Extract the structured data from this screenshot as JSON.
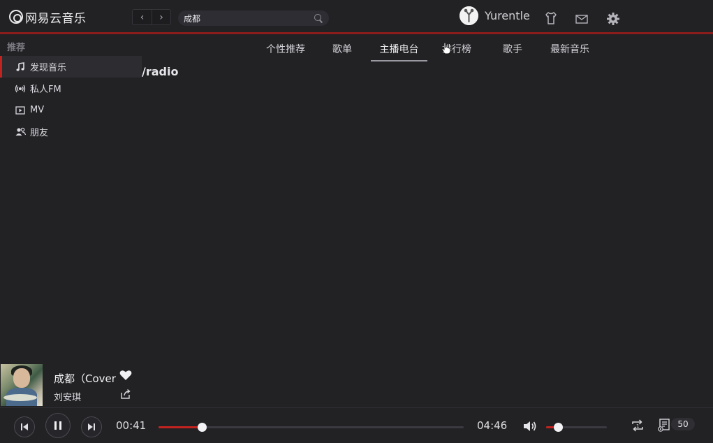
{
  "app": {
    "logo_text": "网易云音乐"
  },
  "header": {
    "back_glyph": "‹",
    "forward_glyph": "›",
    "search_value": "成都",
    "username": "Yurentle",
    "icons": [
      "skin-icon",
      "mail-icon",
      "settings-icon"
    ]
  },
  "sidebar": {
    "section_title": "推荐",
    "items": [
      {
        "label": "发现音乐",
        "icon": "music-note-icon",
        "active": true
      },
      {
        "label": "私人FM",
        "icon": "radio-icon",
        "active": false
      },
      {
        "label": "MV",
        "icon": "video-icon",
        "active": false
      },
      {
        "label": "朋友",
        "icon": "friends-icon",
        "active": false
      }
    ]
  },
  "tabs": [
    {
      "label": "个性推荐",
      "active": false
    },
    {
      "label": "歌单",
      "active": false
    },
    {
      "label": "主播电台",
      "active": true
    },
    {
      "label": "排行榜",
      "active": false
    },
    {
      "label": "歌手",
      "active": false
    },
    {
      "label": "最新音乐",
      "active": false
    }
  ],
  "main": {
    "route_text": "/radio"
  },
  "now_playing": {
    "title": "成都（Cover",
    "artist": "刘安琪",
    "liked": true
  },
  "player": {
    "current_time": "00:41",
    "total_time": "04:46",
    "progress_fraction": 0.143,
    "volume_fraction": 0.2,
    "playlist_count": "50",
    "accent_color": "#c3231f"
  }
}
